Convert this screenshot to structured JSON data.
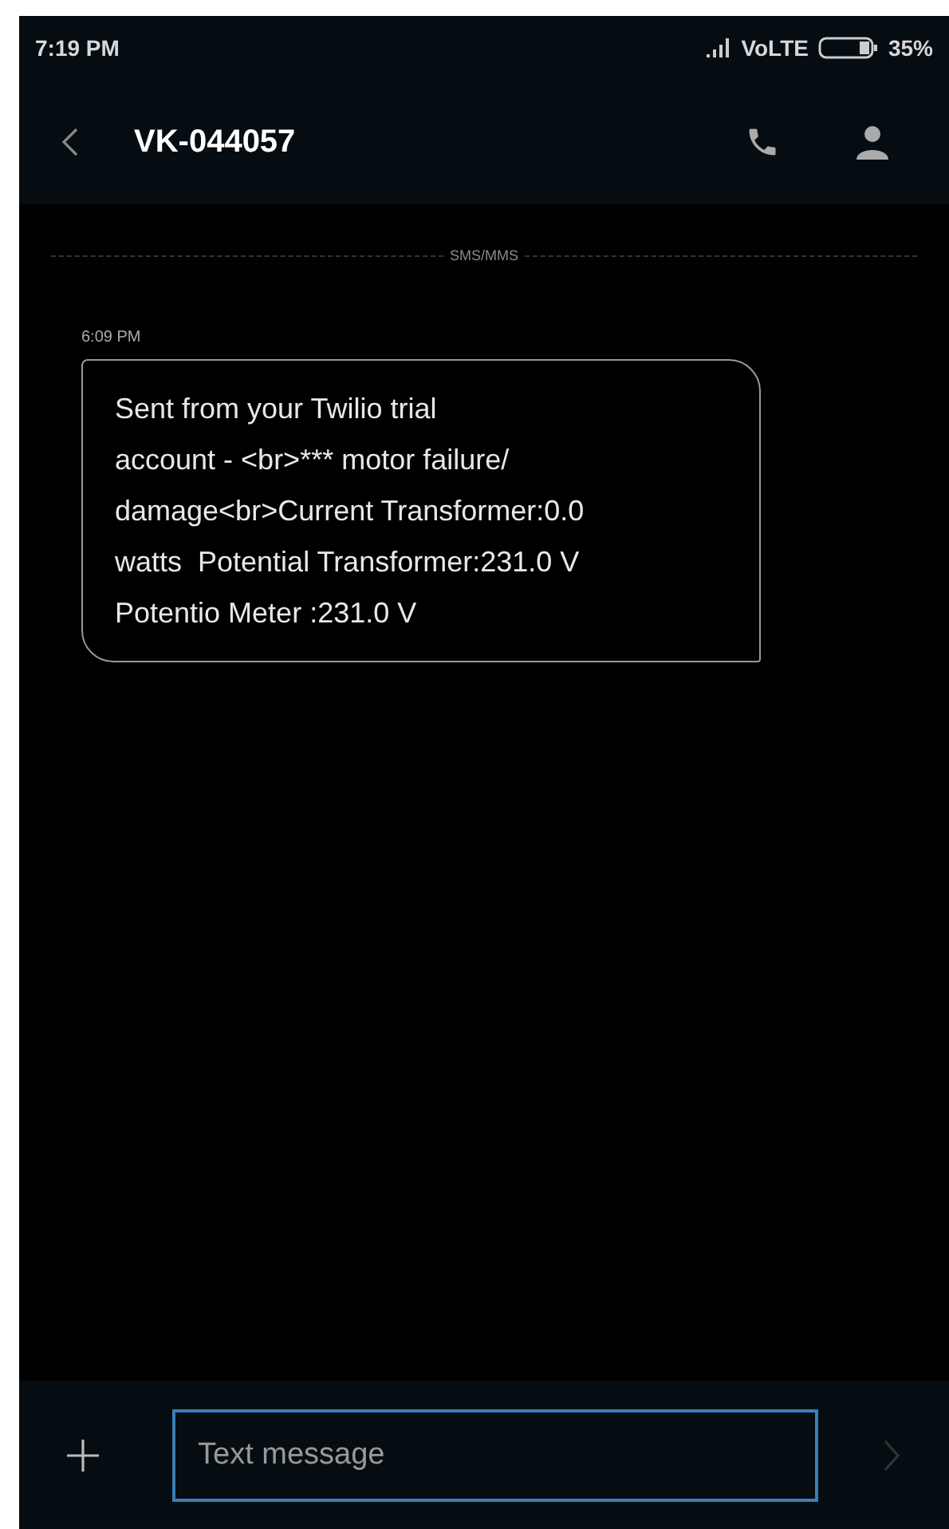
{
  "status_bar": {
    "time": "7:19 PM",
    "network": "VoLTE",
    "battery": "35%"
  },
  "header": {
    "title": "VK-044057"
  },
  "divider_label": "SMS/MMS",
  "messages": [
    {
      "time": "6:09 PM",
      "text": "Sent from your Twilio trial\naccount - <br>*** motor failure/\ndamage<br>Current Transformer:0.0\nwatts  Potential Transformer:231.0 V\nPotentio Meter :231.0 V"
    }
  ],
  "composer": {
    "placeholder": "Text message",
    "send_disabled": true
  }
}
